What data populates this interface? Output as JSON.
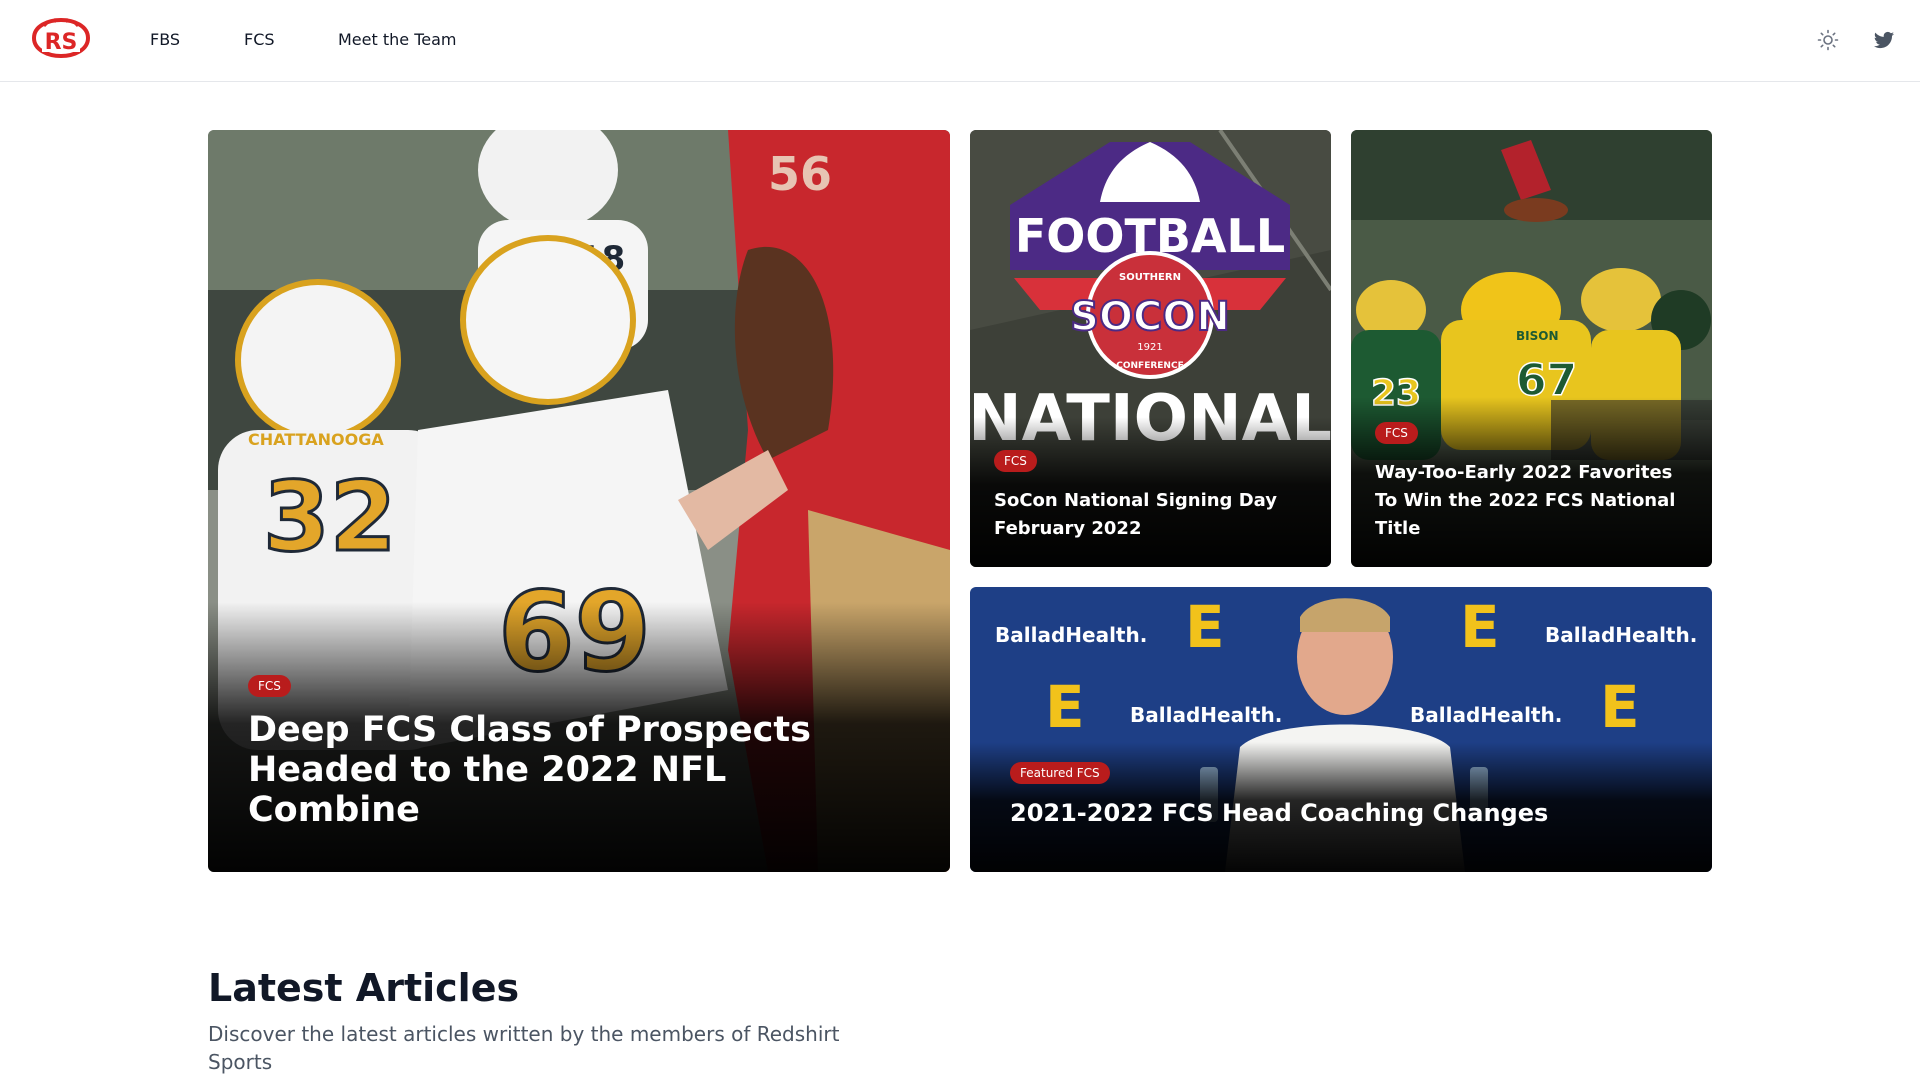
{
  "site": {
    "logo_text": "RS",
    "brand_color": "#dc2626"
  },
  "nav": {
    "items": [
      {
        "label": "FBS"
      },
      {
        "label": "FCS"
      },
      {
        "label": "Meet the Team"
      }
    ],
    "theme_toggle_icon": "sun-icon",
    "social_icon": "twitter-icon"
  },
  "featured": {
    "main": {
      "tag": "FCS",
      "title": "Deep FCS Class of Prospects Headed to the 2022 NFL Combine",
      "jersey_numbers": [
        "32",
        "69",
        "18",
        "56"
      ],
      "jersey_team": "CHATTANOOGA"
    },
    "socon": {
      "tag": "FCS",
      "title": "SoCon National Signing Day February 2022",
      "logo_word": "FOOTBALL",
      "logo_name": "SOCON",
      "logo_arc_top": "SOUTHERN",
      "logo_arc_bottom": "CONFERENCE",
      "logo_year": "1921",
      "big_word": "NATIONAL"
    },
    "bison": {
      "tag": "FCS",
      "title": "Way-Too-Early 2022 Favorites To Win the 2022 FCS National Title",
      "jersey_numbers": [
        "67",
        "23"
      ],
      "jersey_team": "BISON"
    },
    "coaching": {
      "tag": "Featured FCS",
      "title": "2021-2022 FCS Head Coaching Changes",
      "sponsor": "BalladHealth.",
      "backdrop_letter": "E"
    }
  },
  "latest": {
    "heading": "Latest Articles",
    "description": "Discover the latest articles written by the members of Redshirt Sports"
  }
}
